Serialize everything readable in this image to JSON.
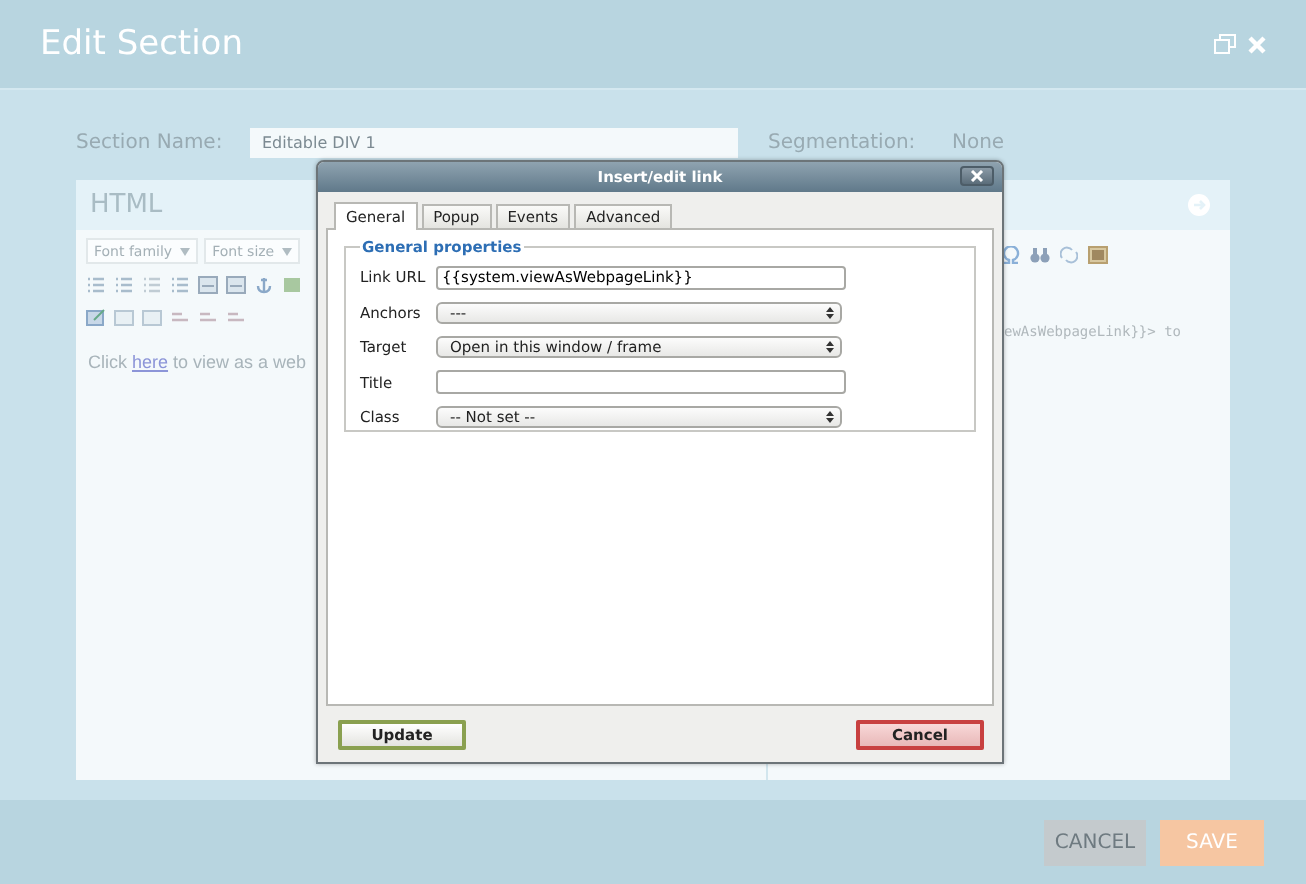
{
  "window": {
    "title": "Edit Section"
  },
  "section_name": {
    "label": "Section Name:",
    "value": "Editable DIV 1"
  },
  "segmentation": {
    "label": "Segmentation:",
    "value": "None"
  },
  "editor": {
    "title": "HTML",
    "font_family": "Font family",
    "font_size": "Font size",
    "content": {
      "before": "Click ",
      "link": "here",
      "after": " to view as a web"
    }
  },
  "source_view": {
    "text": "ewAsWebpageLink}}> to"
  },
  "dialog": {
    "title": "Insert/edit link",
    "tabs": [
      {
        "label": "General",
        "selected": true
      },
      {
        "label": "Popup",
        "selected": false
      },
      {
        "label": "Events",
        "selected": false
      },
      {
        "label": "Advanced",
        "selected": false
      }
    ],
    "legend": "General properties",
    "fields": [
      {
        "label": "Link URL",
        "kind": "text",
        "value": "{{system.viewAsWebpageLink}}"
      },
      {
        "label": "Anchors",
        "kind": "select",
        "value": "---"
      },
      {
        "label": "Target",
        "kind": "select",
        "value": "Open in this window / frame"
      },
      {
        "label": "Title",
        "kind": "text"
      },
      {
        "label": "Class",
        "kind": "select",
        "value": "-- Not set --"
      }
    ],
    "buttons": [
      {
        "label": "Update",
        "kind": "confirm"
      },
      {
        "label": "Cancel",
        "kind": "cancel"
      }
    ]
  },
  "footer_buttons": [
    {
      "label": "CANCEL",
      "kind": "secondary"
    },
    {
      "label": "SAVE",
      "kind": "primary"
    }
  ]
}
